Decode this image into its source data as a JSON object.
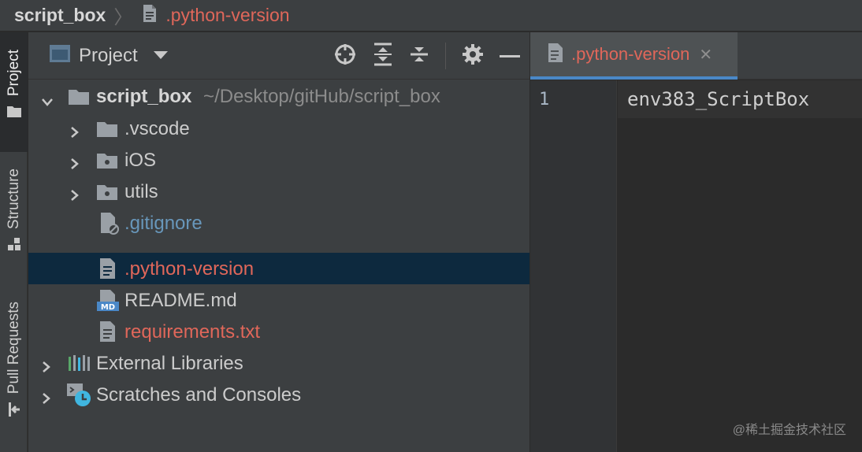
{
  "breadcrumb": {
    "project": "script_box",
    "file": ".python-version"
  },
  "tool_strip": {
    "tabs": [
      "Project",
      "Structure",
      "Pull Requests"
    ]
  },
  "project_panel": {
    "title": "Project",
    "icons": [
      "locate-icon",
      "expand-all-icon",
      "collapse-all-icon",
      "gear-icon",
      "minimize-icon"
    ],
    "tree": [
      {
        "label": "script_box",
        "path": "~/Desktop/gitHub/script_box",
        "icon": "folder-icon",
        "expanded": true
      },
      {
        "label": ".vscode",
        "icon": "folder-icon",
        "expanded": false
      },
      {
        "label": "iOS",
        "icon": "module-folder-icon",
        "expanded": false
      },
      {
        "label": "utils",
        "icon": "module-folder-icon",
        "expanded": false
      },
      {
        "label": ".gitignore",
        "icon": "ignored-file-icon",
        "color": "#6897bb"
      },
      {
        "label": ".python-version",
        "icon": "text-file-icon",
        "color": "#e0675a",
        "selected": true
      },
      {
        "label": "README.md",
        "icon": "markdown-file-icon"
      },
      {
        "label": "requirements.txt",
        "icon": "text-file-icon",
        "color": "#e0675a"
      },
      {
        "label": "External Libraries",
        "icon": "libraries-icon",
        "expanded": false
      },
      {
        "label": "Scratches and Consoles",
        "icon": "scratches-icon",
        "expanded": false
      }
    ]
  },
  "editor": {
    "tab_label": ".python-version",
    "line_number": "1",
    "line_text": "env383_ScriptBox"
  },
  "watermark": "@稀土掘金技术社区",
  "colors": {
    "accent": "#4a88c7",
    "modified_file": "#e0675a",
    "ignored_file": "#6897bb",
    "selection": "#0d293e"
  }
}
